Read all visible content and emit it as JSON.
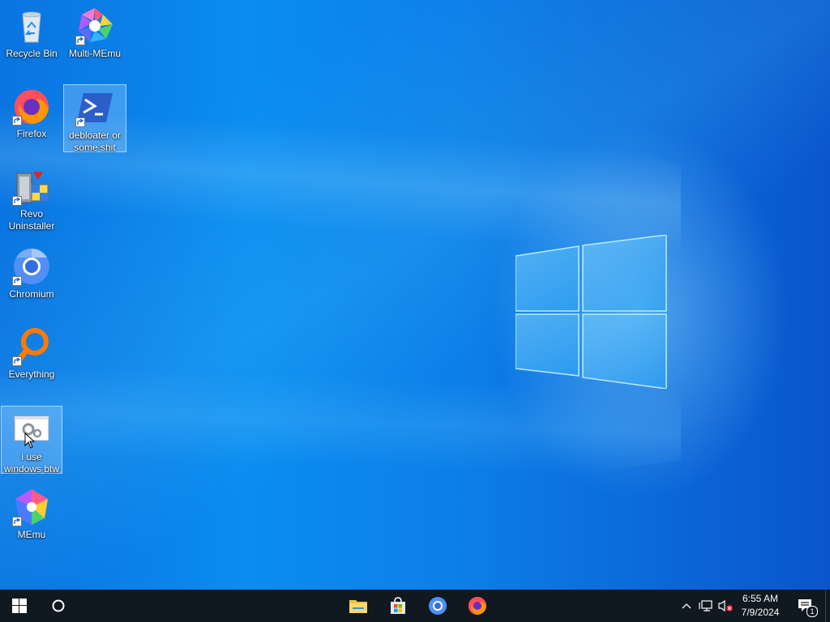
{
  "desktop": {
    "icons": [
      {
        "label": "Recycle Bin",
        "icon": "recycle-bin-icon"
      },
      {
        "label": "Multi-MEmu",
        "icon": "multi-memu-icon"
      },
      {
        "label": "Firefox",
        "icon": "firefox-icon"
      },
      {
        "label": "debloater or some shit",
        "icon": "powershell-icon"
      },
      {
        "label": "Revo Uninstaller",
        "icon": "revo-uninstaller-icon"
      },
      {
        "label": "Chromium",
        "icon": "chromium-icon"
      },
      {
        "label": "Everything",
        "icon": "everything-search-icon"
      },
      {
        "label": "i use windows btw",
        "icon": "settings-gears-icon"
      },
      {
        "label": "MEmu",
        "icon": "memu-icon"
      }
    ]
  },
  "taskbar": {
    "pinned": [
      {
        "name": "File Explorer",
        "icon": "file-explorer-icon"
      },
      {
        "name": "Microsoft Store",
        "icon": "store-icon"
      },
      {
        "name": "Chromium",
        "icon": "chromium-icon"
      },
      {
        "name": "Firefox",
        "icon": "firefox-icon"
      }
    ],
    "clock": {
      "time": "6:55 AM",
      "date": "7/9/2024"
    },
    "notifications": {
      "count": "1"
    }
  },
  "colors": {
    "taskbar": "#101820",
    "accent": "#0a74e0"
  }
}
